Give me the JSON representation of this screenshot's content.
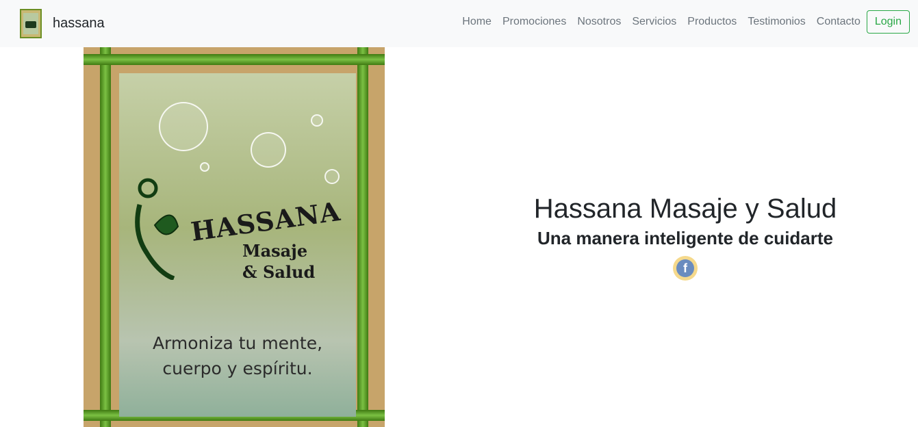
{
  "navbar": {
    "brand_name": "hassana",
    "links": [
      "Home",
      "Promociones",
      "Nosotros",
      "Servicios",
      "Productos",
      "Testimonios",
      "Contacto"
    ],
    "login_label": "Login"
  },
  "poster": {
    "title": "HASSANA",
    "subtitle_line1": "Masaje",
    "subtitle_line2": "& Salud",
    "tagline_line1": "Armoniza tu mente,",
    "tagline_line2": "cuerpo y espíritu."
  },
  "hero": {
    "title": "Hassana Masaje y Salud",
    "subtitle": "Una manera inteligente de cuidarte",
    "facebook_glyph": "f"
  },
  "colors": {
    "navbar_bg": "#f8f9fa",
    "login_accent": "#28a745",
    "bamboo": "#7bc043"
  },
  "icons": {
    "social": "facebook-icon"
  }
}
